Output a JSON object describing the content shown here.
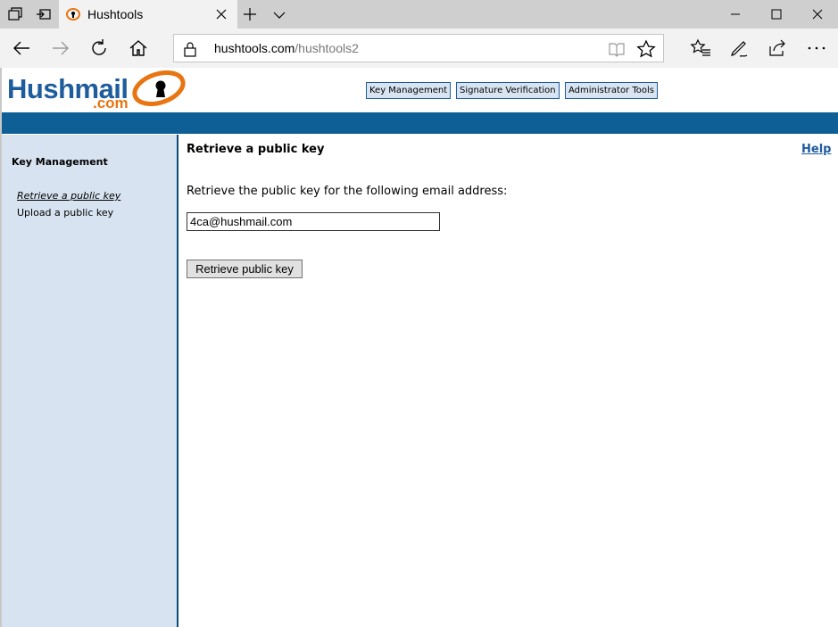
{
  "browser": {
    "tab_title": "Hushtools",
    "url_host": "hushtools.com",
    "url_path": "/hushtools2"
  },
  "logo": {
    "hush": "Hush",
    "mail": "mail",
    "dotcom": ".com"
  },
  "top_nav": [
    {
      "label": "Key Management"
    },
    {
      "label": "Signature Verification"
    },
    {
      "label": "Administrator Tools"
    }
  ],
  "sidebar": {
    "title": "Key Management",
    "links": [
      {
        "label": "Retrieve a public key",
        "current": true
      },
      {
        "label": "Upload a public key",
        "current": false
      }
    ]
  },
  "content": {
    "title": "Retrieve a public key",
    "help": "Help",
    "instruction": "Retrieve the public key for the following email address:",
    "email_value": "4ca@hushmail.com",
    "submit_label": "Retrieve public key"
  },
  "colors": {
    "band": "#0d5f95",
    "sidebar": "#d7e3f0",
    "brand_blue": "#1f5c9e",
    "brand_orange": "#e87511"
  }
}
